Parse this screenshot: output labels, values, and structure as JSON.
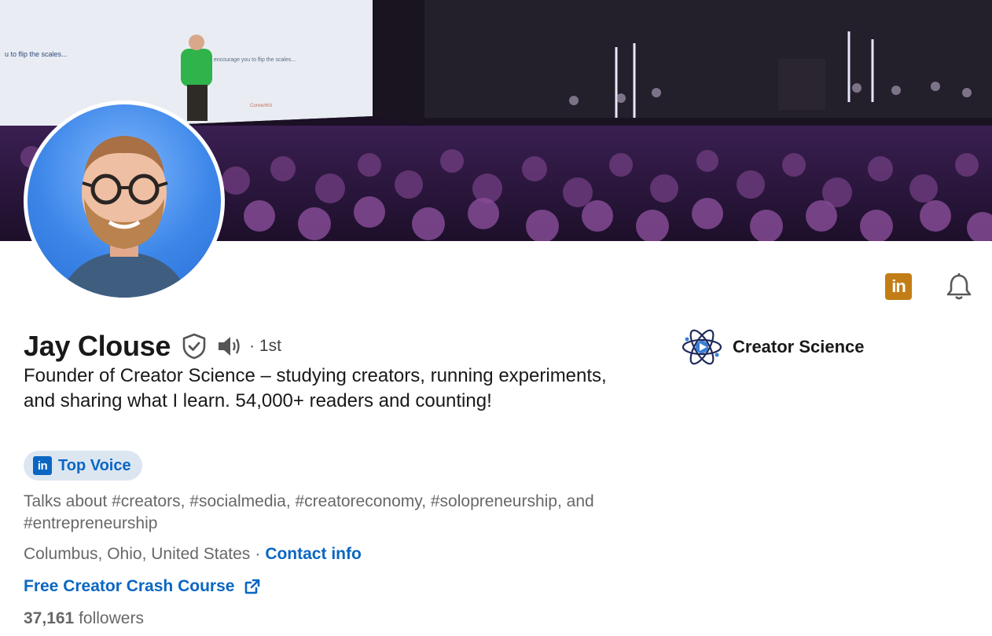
{
  "profile": {
    "name": "Jay Clouse",
    "degree": "· 1st",
    "headline": "Founder of Creator Science – studying creators, running experiments, and sharing what I learn. 54,000+ readers and counting!",
    "badge_label": "Top Voice",
    "talks_about": "Talks about #creators, #socialmedia, #creatoreconomy, #solopreneurship, and #entrepreneurship",
    "location": "Columbus, Ohio, United States",
    "separator": "·",
    "contact_label": "Contact info",
    "website_label": "Free Creator Crash Course",
    "followers_count": "37,161",
    "followers_label": "followers"
  },
  "company": {
    "name": "Creator Science"
  },
  "cover": {
    "slide_text_left": "u to flip the scales...",
    "slide_text_right": "I encourage you to flip the scales...",
    "slide_brand": "ConvertKit"
  },
  "icons": {
    "linkedin_badge": "linkedin-icon",
    "bell": "bell-icon",
    "verified": "shield-check-icon",
    "pronunciation": "speaker-icon",
    "external_link": "external-link-icon"
  },
  "colors": {
    "link_blue": "#0a66c2",
    "badge_bg": "#dce6f1",
    "linkedin_gold": "#c37d16"
  }
}
